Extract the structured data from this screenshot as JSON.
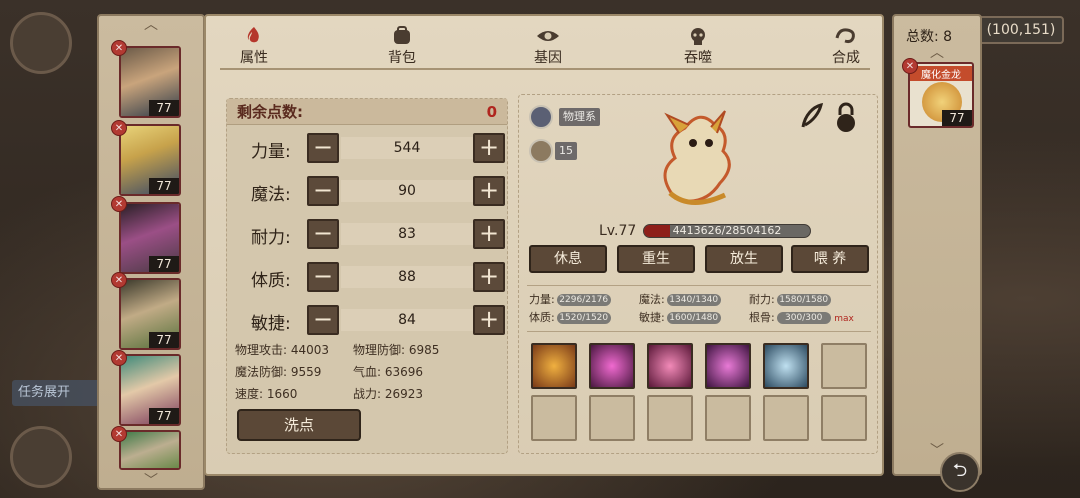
{
  "coords": "(100,151)",
  "mission_tab": "任务展开",
  "tabs": [
    {
      "label": "属性",
      "active": true
    },
    {
      "label": "背包",
      "active": false
    },
    {
      "label": "基因",
      "active": false
    },
    {
      "label": "吞噬",
      "active": false
    },
    {
      "label": "合成",
      "active": false
    }
  ],
  "heroes": [
    {
      "level": "77"
    },
    {
      "level": "77"
    },
    {
      "level": "77"
    },
    {
      "level": "77"
    },
    {
      "level": "77"
    },
    {
      "level": ""
    }
  ],
  "attributes": {
    "remain_label": "剩余点数:",
    "remain_value": "0",
    "stats": [
      {
        "label": "力量:",
        "value": "544"
      },
      {
        "label": "魔法:",
        "value": "90"
      },
      {
        "label": "耐力:",
        "value": "83"
      },
      {
        "label": "体质:",
        "value": "88"
      },
      {
        "label": "敏捷:",
        "value": "84"
      }
    ],
    "derived": [
      "物理攻击: 44003",
      "物理防御: 6985",
      "魔法防御: 9559",
      "气血: 63696",
      "速度: 1660",
      "战力: 26923"
    ],
    "reset_label": "洗点"
  },
  "pet": {
    "type_label": "物理系",
    "count": "15",
    "level": "Lv.77",
    "exp_text": "4413626/28504162",
    "exp_fraction": 0.155,
    "actions": [
      "休息",
      "重生",
      "放生",
      "喂 养"
    ],
    "aptitudes": [
      {
        "label": "力量:",
        "value": "2296/2176"
      },
      {
        "label": "魔法:",
        "value": "1340/1340"
      },
      {
        "label": "耐力:",
        "value": "1580/1580"
      },
      {
        "label": "体质:",
        "value": "1520/1520"
      },
      {
        "label": "敏捷:",
        "value": "1600/1480"
      },
      {
        "label": "根骨:",
        "value": "300/300"
      }
    ],
    "max_label": "max",
    "skills": [
      "orange-flame",
      "pink-claw",
      "pink-shield",
      "pink-star",
      "blue-ice",
      "",
      "",
      "",
      "",
      "",
      "",
      ""
    ]
  },
  "right": {
    "total_label": "总数: 8",
    "pet_name": "魔化金龙",
    "pet_level": "77"
  },
  "colors": {
    "panel": "#e3d7c0",
    "button": "#5b4837",
    "hp": "#8e1f1a",
    "accent_red": "#b0261f"
  }
}
